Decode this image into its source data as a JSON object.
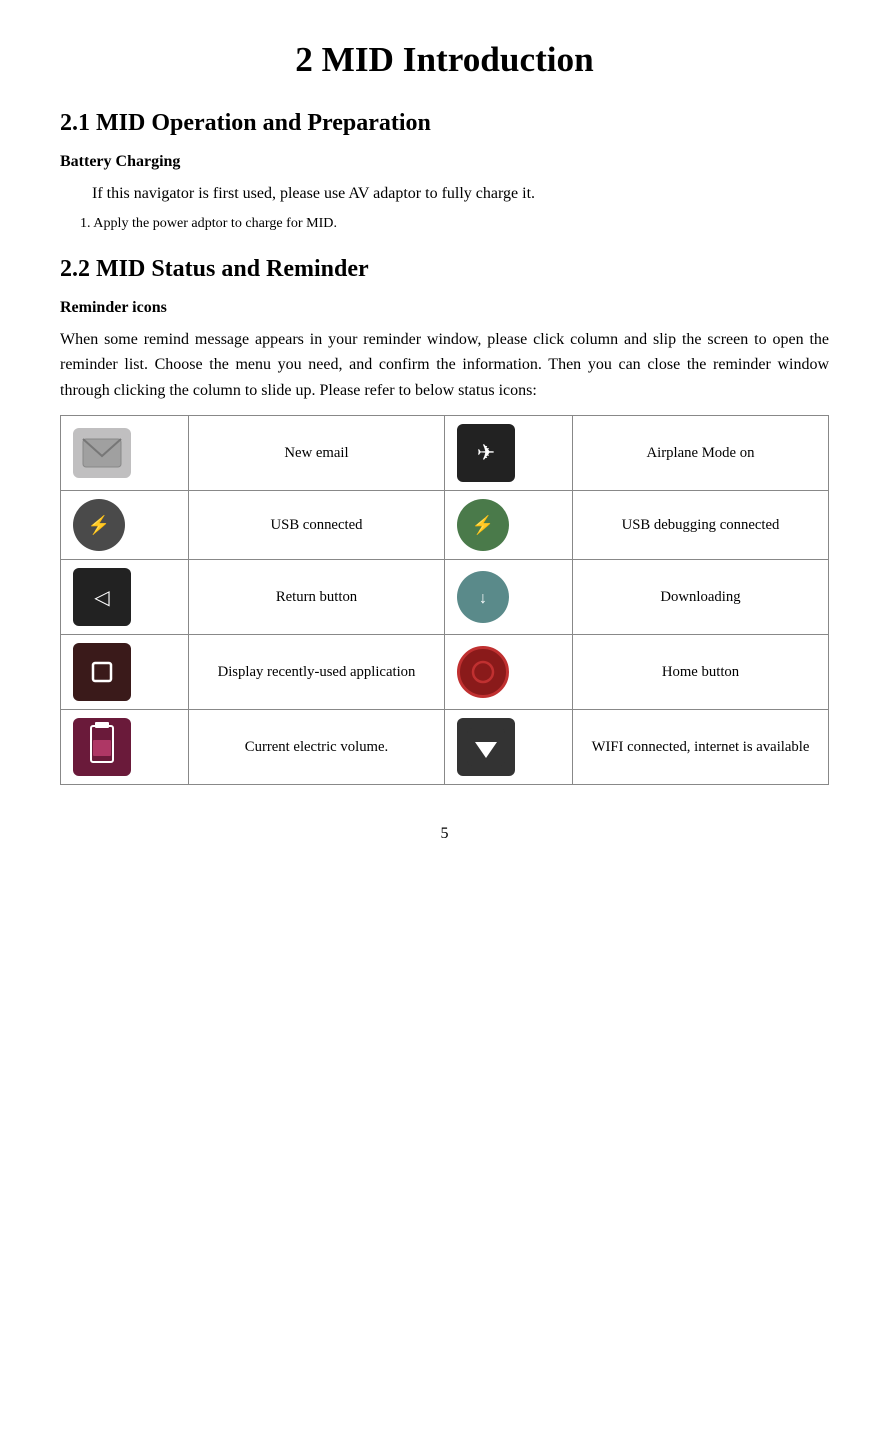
{
  "page": {
    "title": "2 MID Introduction",
    "section1_heading": "2.1 MID Operation and Preparation",
    "battery_heading": "Battery Charging",
    "battery_text1": "If this navigator is first used, please use AV adaptor to fully charge it.",
    "battery_text2": "1. Apply the power adptor to charge for MID.",
    "section2_heading": "2.2 MID Status and Reminder",
    "reminder_heading": "Reminder icons",
    "reminder_paragraph": "When some remind message appears in your reminder window, please click column and slip the screen to open the reminder list. Choose the menu you need, and confirm the information. Then you can close the reminder window through clicking the column to slide up. Please refer to below status icons:",
    "table": {
      "rows": [
        {
          "icon1_name": "email-icon",
          "label1": "New email",
          "icon2_name": "airplane-icon",
          "label2": "Airplane Mode on"
        },
        {
          "icon1_name": "usb-icon",
          "label1": "USB connected",
          "icon2_name": "usb-debug-icon",
          "label2": "USB debugging connected"
        },
        {
          "icon1_name": "return-icon",
          "label1": "Return button",
          "icon2_name": "downloading-icon",
          "label2": "Downloading"
        },
        {
          "icon1_name": "recent-apps-icon",
          "label1": "Display      recently-used application",
          "icon2_name": "home-icon",
          "label2": "Home button"
        },
        {
          "icon1_name": "battery-icon",
          "label1": "Current electric volume.",
          "icon2_name": "wifi-icon",
          "label2": "WIFI connected, internet is available"
        }
      ]
    },
    "page_number": "5"
  }
}
